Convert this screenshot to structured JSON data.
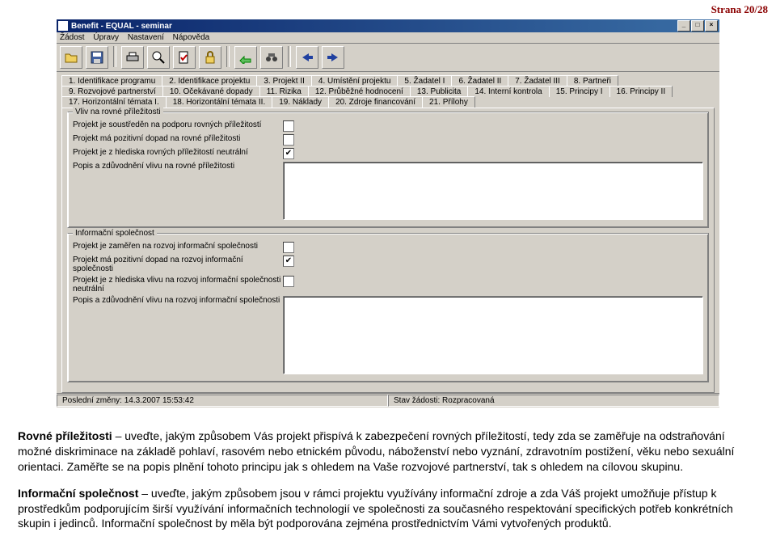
{
  "page_header": "Strana 20/28",
  "window": {
    "title": "Benefit - EQUAL - seminar",
    "min": "_",
    "max": "□",
    "close": "×"
  },
  "menu": {
    "m1": "Žádost",
    "m2": "Úpravy",
    "m3": "Nastavení",
    "m4": "Nápověda"
  },
  "tabs_row1": {
    "t1": "1. Identifikace programu",
    "t2": "2. Identifikace projektu",
    "t3": "3. Projekt II",
    "t4": "4. Umístění projektu",
    "t5": "5. Žadatel I",
    "t6": "6. Žadatel II",
    "t7": "7. Žadatel III",
    "t8": "8. Partneři"
  },
  "tabs_row2": {
    "t9": "9. Rozvojové partnerství",
    "t10": "10. Očekávané dopady",
    "t11": "11. Rizika",
    "t12": "12. Průběžné hodnocení",
    "t13": "13. Publicita",
    "t14": "14. Interní kontrola",
    "t15": "15. Principy I",
    "t16": "16. Principy II"
  },
  "tabs_row3": {
    "t17": "17. Horizontální témata I.",
    "t18": "18. Horizontální témata II.",
    "t19": "19. Náklady",
    "t20": "20. Zdroje financování",
    "t21": "21. Přílohy"
  },
  "group1": {
    "legend": "Vliv na rovné příležitosti",
    "r1": "Projekt je soustředěn na podporu rovných příležitostí",
    "r2": "Projekt má pozitivní dopad na rovné příležitosti",
    "r3": "Projekt je z hlediska rovných příležitostí neutrální",
    "r4": "Popis a zdůvodnění vlivu na rovné příležitosti"
  },
  "group2": {
    "legend": "Informační společnost",
    "r1": "Projekt je zaměřen na rozvoj informační společnosti",
    "r2": "Projekt má pozitivní dopad na rozvoj informační společnosti",
    "r3": "Projekt je z hlediska vlivu na rozvoj informační společnosti neutrální",
    "r4": "Popis a zdůvodnění vlivu na rozvoj informační společnosti"
  },
  "status": {
    "left": "Poslední změny: 14.3.2007 15:53:42",
    "right": "Stav žádosti: Rozpracovaná"
  },
  "instruction": {
    "p1a": "Rovné příležitosti",
    "p1b": " – uveďte, jakým způsobem Vás projekt přispívá k zabezpečení rovných příležitostí, tedy zda se zaměřuje na odstraňování možné diskriminace na základě pohlaví, rasovém nebo etnickém původu, náboženství nebo vyznání, zdravotním postižení, věku nebo sexuální orientaci. Zaměřte se na popis plnění tohoto principu jak s ohledem na Vaše rozvojové partnerství, tak s ohledem na cílovou skupinu.",
    "p2a": "Informační společnost",
    "p2b": " – uveďte, jakým způsobem jsou v rámci projektu využívány informační zdroje a zda Váš projekt umožňuje přístup k prostředkům podporujícím širší využívání informačních technologií ve společnosti za současného respektování specifických potřeb konkrétních skupin i jedinců. Informační společnost by měla být podporována zejména prostřednictvím Vámi vytvořených produktů."
  }
}
